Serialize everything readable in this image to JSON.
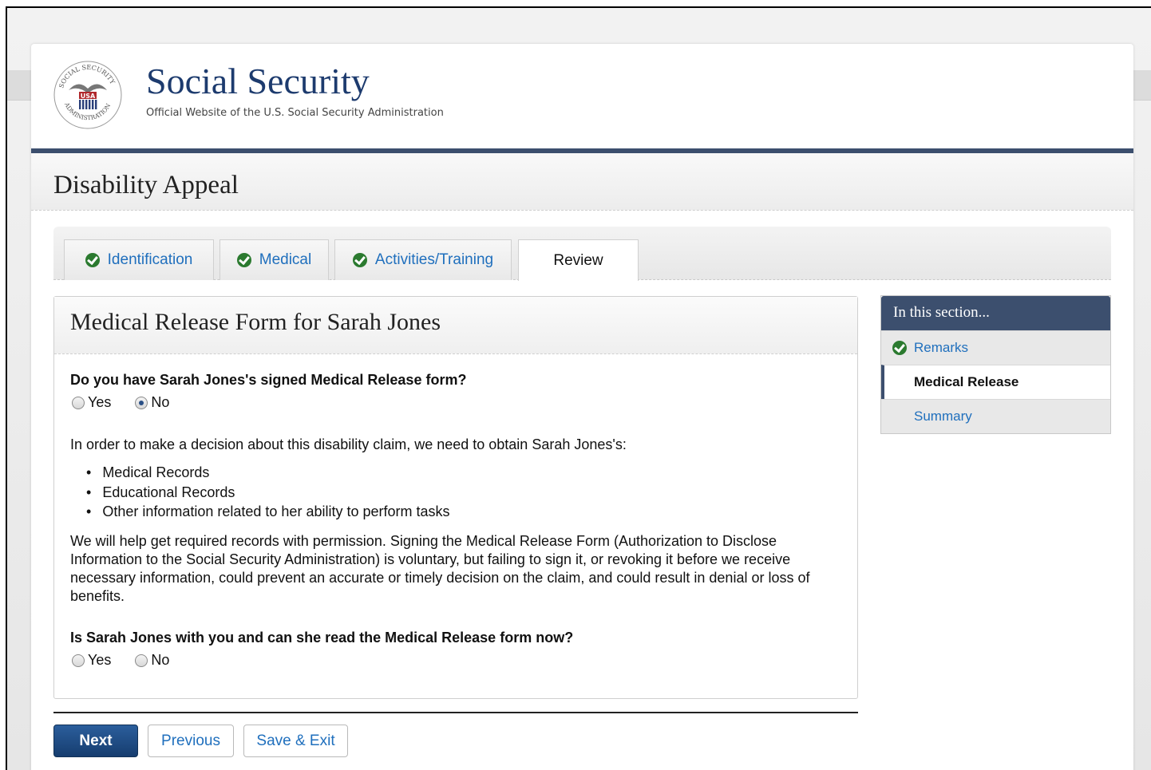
{
  "site": {
    "title": "Social Security",
    "subtitle": "Official Website of the U.S. Social Security Administration",
    "seal_text": "SOCIAL SECURITY ADMINISTRATION",
    "seal_usa": "USA"
  },
  "page_title": "Disability Appeal",
  "tabs": [
    {
      "label": "Identification",
      "completed": true
    },
    {
      "label": "Medical",
      "completed": true
    },
    {
      "label": "Activities/Training",
      "completed": true
    },
    {
      "label": "Review",
      "completed": false,
      "active": true
    }
  ],
  "panel": {
    "title": "Medical Release Form for Sarah Jones",
    "q1": {
      "text": "Do you have Sarah Jones's signed Medical Release form?",
      "options": [
        "Yes",
        "No"
      ],
      "selected": "No"
    },
    "intro": "In order to make a decision about this disability claim, we need to obtain Sarah Jones's:",
    "bullets": [
      "Medical Records",
      "Educational Records",
      "Other information related to her ability to perform tasks"
    ],
    "info": "We will help get required records with permission. Signing the Medical Release Form (Authorization to Disclose Information to the Social Security Administration) is voluntary, but failing to sign it, or revoking it before we receive necessary information, could prevent an accurate or timely decision on the claim, and could result in denial or loss of benefits.",
    "q2": {
      "text": "Is Sarah Jones with you and can she read the Medical Release form now?",
      "options": [
        "Yes",
        "No"
      ],
      "selected": null
    }
  },
  "buttons": {
    "next": "Next",
    "previous": "Previous",
    "save_exit": "Save & Exit"
  },
  "sidebar": {
    "heading": "In this section...",
    "items": [
      {
        "label": "Remarks",
        "state": "completed"
      },
      {
        "label": "Medical Release",
        "state": "current"
      },
      {
        "label": "Summary",
        "state": "pending"
      }
    ]
  },
  "colors": {
    "navy": "#3c4f6e",
    "link": "#1f6fbd",
    "check": "#2b7a2f",
    "button": "#1d4677"
  }
}
